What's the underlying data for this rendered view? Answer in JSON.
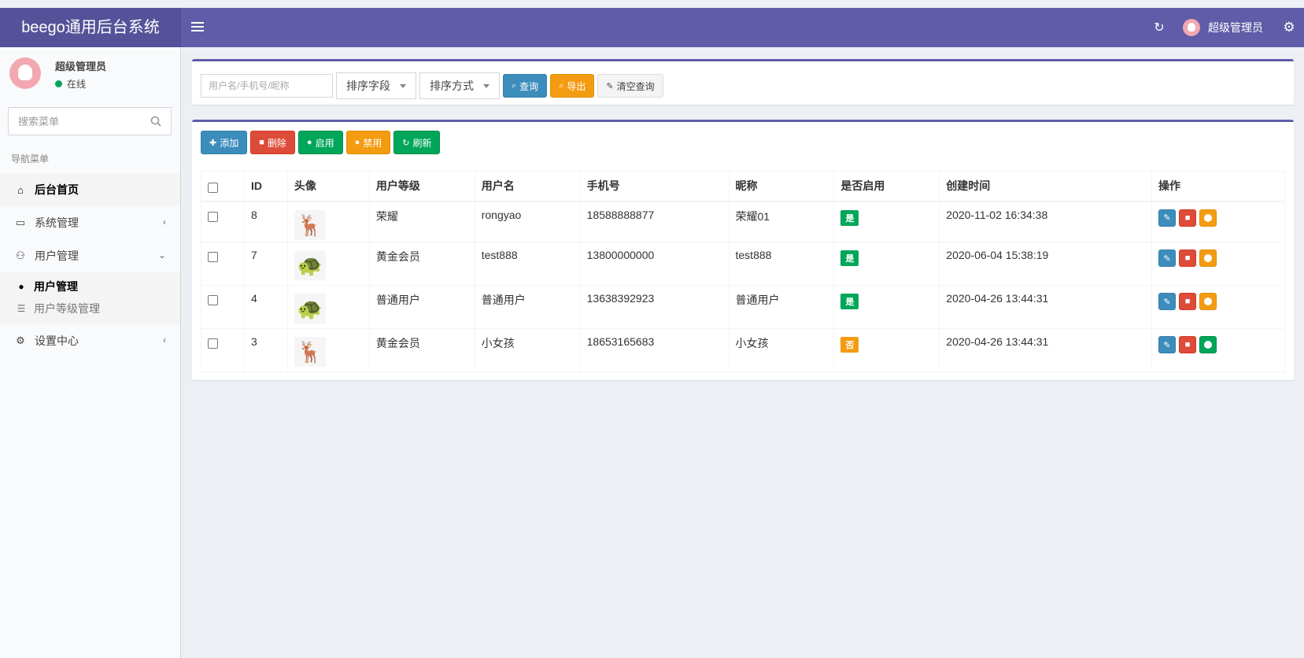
{
  "header": {
    "logo": "beego通用后台系统",
    "user_name": "超级管理员"
  },
  "sidebar": {
    "user": {
      "name": "超级管理员",
      "status": "在线"
    },
    "search_placeholder": "搜索菜单",
    "nav_header": "导航菜单",
    "items": [
      {
        "label": "后台首页",
        "icon": "home-icon"
      },
      {
        "label": "系统管理",
        "icon": "desktop-icon"
      },
      {
        "label": "用户管理",
        "icon": "users-icon"
      },
      {
        "label": "设置中心",
        "icon": "gears-icon"
      }
    ],
    "subitems": [
      {
        "label": "用户管理",
        "icon": "user-icon"
      },
      {
        "label": "用户等级管理",
        "icon": "list-icon"
      }
    ]
  },
  "filter": {
    "input_placeholder": "用户名/手机号/昵称",
    "sort_field": "排序字段",
    "sort_order": "排序方式",
    "query": "查询",
    "export": "导出",
    "clear": "清空查询"
  },
  "toolbar": {
    "add": "添加",
    "delete": "删除",
    "enable": "启用",
    "disable": "禁用",
    "refresh": "刷新"
  },
  "table": {
    "columns": [
      "ID",
      "头像",
      "用户等级",
      "用户名",
      "手机号",
      "昵称",
      "是否启用",
      "创建时间",
      "操作"
    ],
    "rows": [
      {
        "id": "8",
        "avatar": "deer",
        "level": "荣耀",
        "username": "rongyao",
        "phone": "18588888877",
        "nickname": "荣耀01",
        "enabled": "是",
        "created": "2020-11-02 16:34:38"
      },
      {
        "id": "7",
        "avatar": "turtle",
        "level": "黄金会员",
        "username": "test888",
        "phone": "13800000000",
        "nickname": "test888",
        "enabled": "是",
        "created": "2020-06-04 15:38:19"
      },
      {
        "id": "4",
        "avatar": "turtle",
        "level": "普通用户",
        "username": "普通用户",
        "phone": "13638392923",
        "nickname": "普通用户",
        "enabled": "是",
        "created": "2020-04-26 13:44:31"
      },
      {
        "id": "3",
        "avatar": "deer",
        "level": "黄金会员",
        "username": "小女孩",
        "phone": "18653165683",
        "nickname": "小女孩",
        "enabled": "否",
        "created": "2020-04-26 13:44:31"
      }
    ]
  },
  "colors": {
    "header": "#605ca8",
    "blue": "#3c8dbc",
    "red": "#dd4b39",
    "orange": "#f39c12",
    "green": "#00a65a"
  }
}
